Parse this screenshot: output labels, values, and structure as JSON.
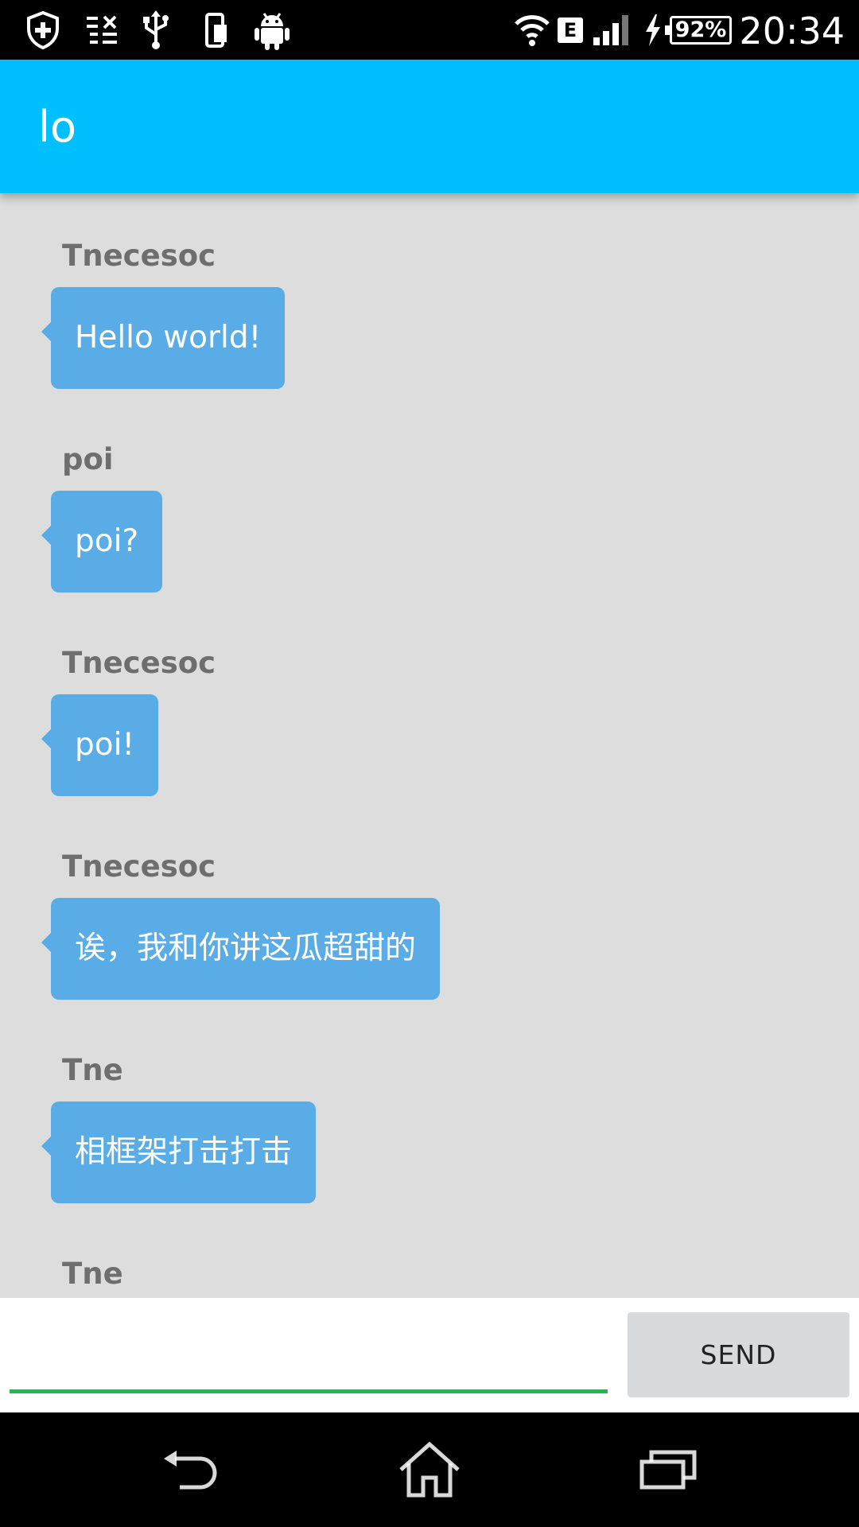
{
  "status_bar": {
    "icons": [
      "shield-plus-icon",
      "sim-off-icon",
      "usb-icon",
      "storage-icon",
      "android-icon",
      "wifi-icon",
      "e-network-icon",
      "signal-icon",
      "charging-icon",
      "battery-icon"
    ],
    "network_label": "E",
    "battery_percent": "92%",
    "time": "20:34"
  },
  "app_bar": {
    "title": "lo"
  },
  "messages": [
    {
      "sender": "Tnecesoc",
      "text": "Hello world!"
    },
    {
      "sender": "poi",
      "text": "poi?"
    },
    {
      "sender": "Tnecesoc",
      "text": "poi!"
    },
    {
      "sender": "Tnecesoc",
      "text": "诶，我和你讲这瓜超甜的"
    },
    {
      "sender": "Tne",
      "text": "相框架打击打击"
    },
    {
      "sender": "Tne",
      "text": ""
    }
  ],
  "input": {
    "value": "",
    "placeholder": ""
  },
  "send_button": {
    "label": "SEND"
  },
  "colors": {
    "app_bar": "#00bfff",
    "bubble": "#5aace6",
    "input_underline": "#1dbb4d",
    "background": "#dddddd"
  },
  "nav_bar": {
    "icons": [
      "back-icon",
      "home-icon",
      "recents-icon"
    ]
  }
}
